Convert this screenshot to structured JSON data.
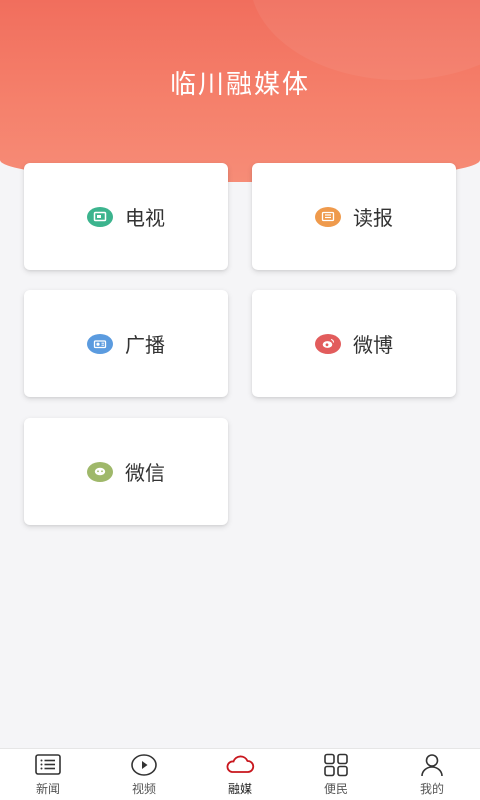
{
  "header": {
    "title": "临川融媒体"
  },
  "cards": [
    {
      "label": "电视",
      "icon": "tv-icon",
      "color": "#3cb48e"
    },
    {
      "label": "读报",
      "icon": "newspaper-icon",
      "color": "#ef9a4c"
    },
    {
      "label": "广播",
      "icon": "radio-icon",
      "color": "#5b9bdf"
    },
    {
      "label": "微博",
      "icon": "weibo-icon",
      "color": "#e25c5c"
    },
    {
      "label": "微信",
      "icon": "wechat-icon",
      "color": "#9fb86a"
    }
  ],
  "tabbar": {
    "active": "融媒",
    "active_color": "#c8161d",
    "items": [
      {
        "label": "新闻",
        "icon": "list-icon"
      },
      {
        "label": "视频",
        "icon": "play-icon"
      },
      {
        "label": "融媒",
        "icon": "cloud-icon"
      },
      {
        "label": "便民",
        "icon": "grid-icon"
      },
      {
        "label": "我的",
        "icon": "user-icon"
      }
    ]
  }
}
